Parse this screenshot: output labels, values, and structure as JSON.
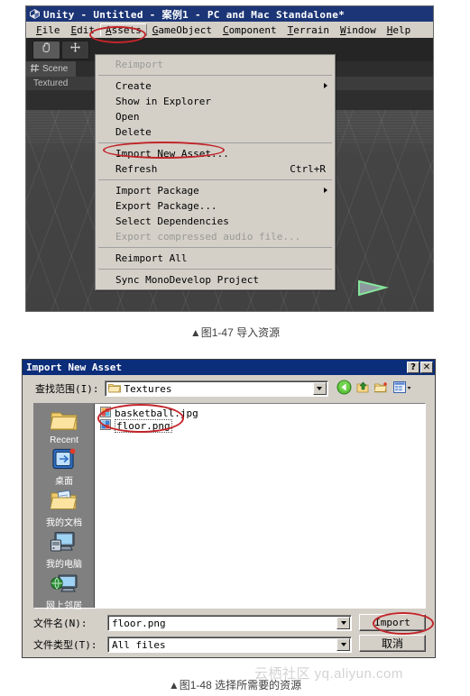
{
  "unity": {
    "title": "Unity - Untitled - 案例1 - PC and Mac Standalone*",
    "logo_icon": "unity-cube-icon",
    "menubar": [
      {
        "label": "File",
        "mnemonic": "F"
      },
      {
        "label": "Edit",
        "mnemonic": "E"
      },
      {
        "label": "Assets",
        "mnemonic": "A"
      },
      {
        "label": "GameObject",
        "mnemonic": "G"
      },
      {
        "label": "Component",
        "mnemonic": "C"
      },
      {
        "label": "Terrain",
        "mnemonic": "T"
      },
      {
        "label": "Window",
        "mnemonic": "W"
      },
      {
        "label": "Help",
        "mnemonic": "H"
      }
    ],
    "toolbar": {
      "hand_tool_icon": "hand-tool-icon",
      "move_tool_icon": "move-tool-icon"
    },
    "scene_tab": {
      "label": "Scene",
      "icon": "scene-grid-icon"
    },
    "scene_toolbar": {
      "draw_mode": "Textured"
    },
    "assets_menu": [
      {
        "label": "Reimport",
        "accel": "",
        "disabled": true,
        "submenu": false
      },
      {
        "separator": true
      },
      {
        "label": "Create",
        "accel": "",
        "disabled": false,
        "submenu": true
      },
      {
        "label": "Show in Explorer",
        "accel": "",
        "disabled": false,
        "submenu": false
      },
      {
        "label": "Open",
        "accel": "",
        "disabled": false,
        "submenu": false
      },
      {
        "label": "Delete",
        "accel": "",
        "disabled": false,
        "submenu": false
      },
      {
        "separator": true
      },
      {
        "label": "Import New Asset...",
        "accel": "",
        "disabled": false,
        "submenu": false
      },
      {
        "label": "Refresh",
        "accel": "Ctrl+R",
        "disabled": false,
        "submenu": false
      },
      {
        "separator": true
      },
      {
        "label": "Import Package",
        "accel": "",
        "disabled": false,
        "submenu": true
      },
      {
        "label": "Export Package...",
        "accel": "",
        "disabled": false,
        "submenu": false
      },
      {
        "label": "Select Dependencies",
        "accel": "",
        "disabled": false,
        "submenu": false
      },
      {
        "label": "Export compressed audio file...",
        "accel": "",
        "disabled": true,
        "submenu": false
      },
      {
        "separator": true
      },
      {
        "label": "Reimport All",
        "accel": "",
        "disabled": false,
        "submenu": false
      },
      {
        "separator": true
      },
      {
        "label": "Sync MonoDevelop Project",
        "accel": "",
        "disabled": false,
        "submenu": false
      }
    ]
  },
  "captions": {
    "fig1": "▲图1-47 导入资源",
    "fig2": "▲图1-48 选择所需要的资源"
  },
  "dialog": {
    "title": "Import New Asset",
    "help_button": "?",
    "close_button": "✕",
    "lookin_label": "查找范围(I):",
    "lookin_value": "Textures",
    "lookin_folder_icon": "folder-icon",
    "toolbar_icons": [
      {
        "name": "back-navigation-icon",
        "glyph": "←"
      },
      {
        "name": "up-one-level-icon",
        "glyph": "↰"
      },
      {
        "name": "new-folder-icon",
        "glyph": "+"
      },
      {
        "name": "views-icon",
        "glyph": "▦"
      }
    ],
    "places": [
      {
        "label": "Recent",
        "icon": "recent-folder-icon"
      },
      {
        "label": "桌面",
        "icon": "desktop-icon"
      },
      {
        "label": "我的文档",
        "icon": "my-documents-icon"
      },
      {
        "label": "我的电脑",
        "icon": "my-computer-icon"
      },
      {
        "label": "网上邻居",
        "icon": "network-neighborhood-icon"
      }
    ],
    "files": [
      {
        "name": "basketball.jpg",
        "icon": "jpg-file-icon",
        "selected": false
      },
      {
        "name": "floor.png",
        "icon": "png-file-icon",
        "selected": true
      }
    ],
    "filename_label": "文件名(N):",
    "filename_value": "floor.png",
    "filetype_label": "文件类型(T):",
    "filetype_value": "All files",
    "import_button": "Import",
    "cancel_button": "取消"
  },
  "watermark": "云栖社区 yq.aliyun.com",
  "colors": {
    "titlebar_blue": "#1b3576",
    "dialog_titlebar_blue": "#0b2d7a",
    "window_face": "#d4d0c8",
    "annotation_red": "#c2252a",
    "scene_dark": "#3a3a3a"
  }
}
